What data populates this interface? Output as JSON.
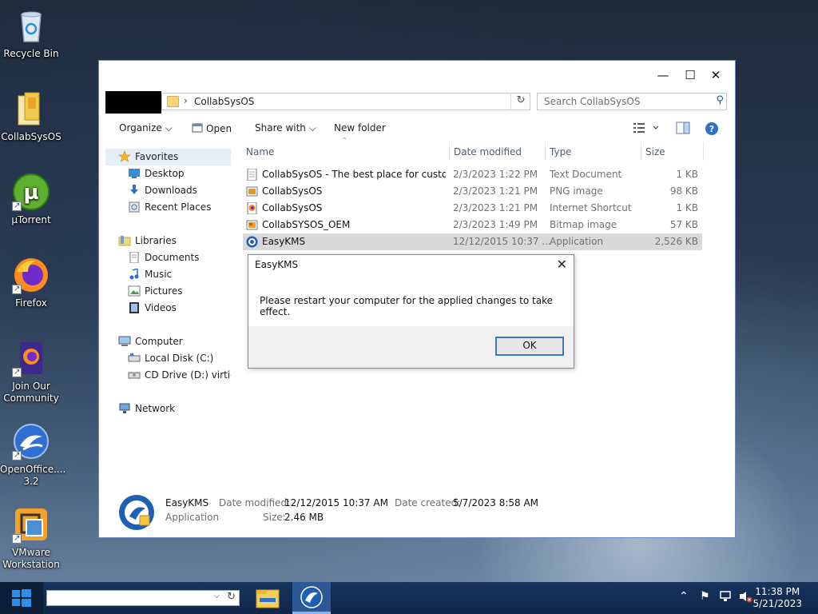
{
  "desktop": {
    "icons": [
      {
        "label": "Recycle Bin",
        "icon": "recycle-bin-icon"
      },
      {
        "label": "CollabSysOS",
        "icon": "folder-icon"
      },
      {
        "label": "µTorrent",
        "icon": "utorrent-icon"
      },
      {
        "label": "Firefox",
        "icon": "firefox-icon"
      },
      {
        "label": "Join Our Community",
        "icon": "firefox-community-icon"
      },
      {
        "label": "OpenOffice.... 3.2",
        "icon": "openoffice-icon"
      },
      {
        "label": "VMware Workstation",
        "icon": "vmware-icon"
      }
    ]
  },
  "explorer": {
    "breadcrumb": "CollabSysOS",
    "search_placeholder": "Search CollabSysOS",
    "toolbar": {
      "organize": "Organize",
      "open": "Open",
      "share_with": "Share with",
      "new_folder": "New folder"
    },
    "nav": {
      "favorites": "Favorites",
      "desktop": "Desktop",
      "downloads": "Downloads",
      "recent_places": "Recent Places",
      "libraries": "Libraries",
      "documents": "Documents",
      "music": "Music",
      "pictures": "Pictures",
      "videos": "Videos",
      "computer": "Computer",
      "local_disk": "Local Disk (C:)",
      "cd_drive": "CD Drive (D:) virtio-win",
      "network": "Network"
    },
    "columns": {
      "name": "Name",
      "date": "Date modified",
      "type": "Type",
      "size": "Size"
    },
    "files": [
      {
        "name": "CollabSysOS - The best place for custom ...",
        "date": "2/3/2023 1:22 PM",
        "type": "Text Document",
        "size": "1 KB",
        "icon": "text-file-icon"
      },
      {
        "name": "CollabSysOS",
        "date": "2/3/2023 1:21 PM",
        "type": "PNG image",
        "size": "98 KB",
        "icon": "png-file-icon"
      },
      {
        "name": "CollabSysOS",
        "date": "2/3/2023 1:21 PM",
        "type": "Internet Shortcut",
        "size": "1 KB",
        "icon": "internet-shortcut-icon"
      },
      {
        "name": "CollabSYSOS_OEM",
        "date": "2/3/2023 1:49 PM",
        "type": "Bitmap image",
        "size": "57 KB",
        "icon": "bitmap-file-icon"
      },
      {
        "name": "EasyKMS",
        "date": "12/12/2015 10:37 ...",
        "type": "Application",
        "size": "2,526 KB",
        "icon": "easykms-app-icon"
      }
    ],
    "details": {
      "name": "EasyKMS",
      "kind": "Application",
      "modified_label": "Date modified:",
      "modified_value": "12/12/2015 10:37 AM",
      "created_label": "Date created:",
      "created_value": "5/7/2023 8:58 AM",
      "size_label": "Size:",
      "size_value": "2.46 MB"
    }
  },
  "dialog": {
    "title": "EasyKMS",
    "message": "Please restart your computer for the applied changes to take effect.",
    "ok": "OK"
  },
  "taskbar": {
    "time": "11:38 PM",
    "date": "5/21/2023"
  }
}
